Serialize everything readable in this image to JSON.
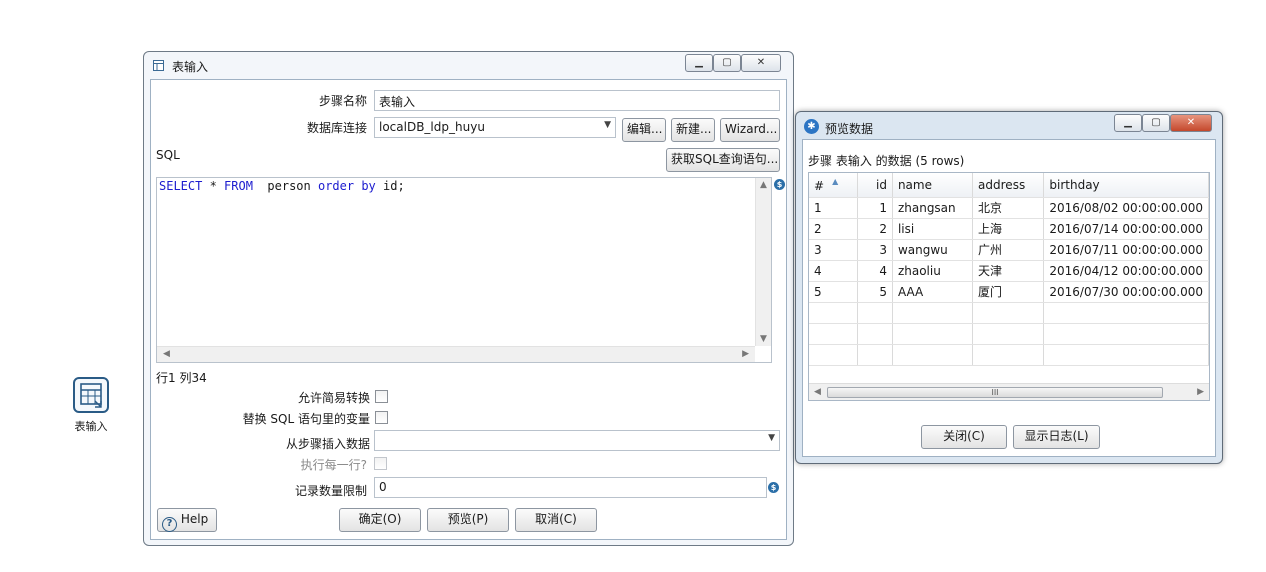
{
  "canvas": {
    "step_label": "表输入"
  },
  "table_input_dialog": {
    "title": "表输入",
    "step_name_label": "步骤名称",
    "step_name_value": "表输入",
    "connection_label": "数据库连接",
    "connection_value": "localDB_ldp_huyu",
    "edit_button": "编辑...",
    "new_button": "新建...",
    "wizard_button": "Wizard...",
    "sql_label": "SQL",
    "get_sql_button": "获取SQL查询语句...",
    "sql_keywords": {
      "select": "SELECT",
      "from": "FROM",
      "order_by": "order by"
    },
    "sql_parts": {
      "star": " * ",
      "table": "  person ",
      "tail": " id;"
    },
    "cursor_position": "行1 列34",
    "lazy_conversion_label": "允许简易转换",
    "replace_vars_label": "替换 SQL 语句里的变量",
    "insert_from_step_label": "从步骤插入数据",
    "insert_from_step_value": "",
    "execute_each_row_label": "执行每一行?",
    "limit_label": "记录数量限制",
    "limit_value": "0",
    "help_button": "Help",
    "ok_button": "确定(O)",
    "preview_button": "预览(P)",
    "cancel_button": "取消(C)"
  },
  "preview_dialog": {
    "title": "预览数据",
    "subtitle": "步骤 表输入 的数据  (5 rows)",
    "columns": [
      "#",
      "id",
      "name",
      "address",
      "birthday"
    ],
    "rows": [
      [
        "1",
        "1",
        "zhangsan",
        "北京",
        "2016/08/02 00:00:00.000"
      ],
      [
        "2",
        "2",
        "lisi",
        "上海",
        "2016/07/14 00:00:00.000"
      ],
      [
        "3",
        "3",
        "wangwu",
        "广州",
        "2016/07/11 00:00:00.000"
      ],
      [
        "4",
        "4",
        "zhaoliu",
        "天津",
        "2016/04/12 00:00:00.000"
      ],
      [
        "5",
        "5",
        "AAA",
        "厦门",
        "2016/07/30 00:00:00.000"
      ]
    ],
    "scroll_thumb": "III",
    "close_button": "关闭(C)",
    "show_log_button": "显示日志(L)"
  }
}
